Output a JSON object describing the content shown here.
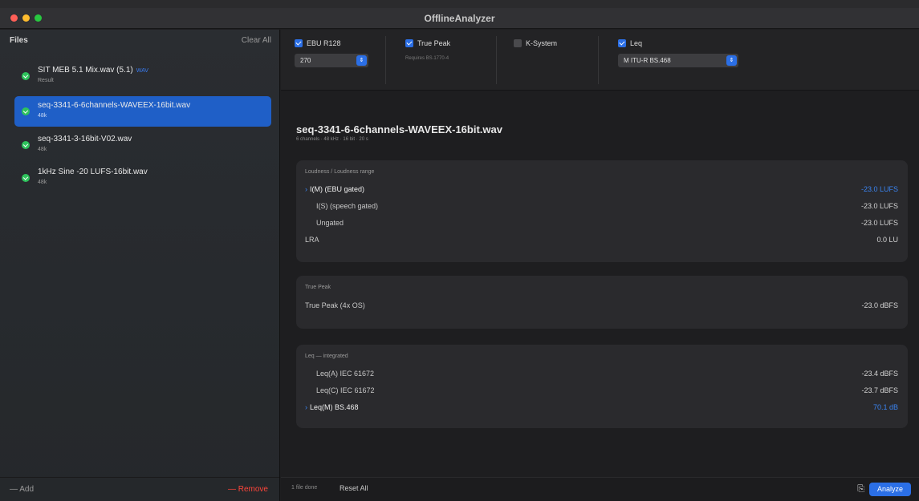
{
  "window": {
    "title": "OfflineAnalyzer"
  },
  "sidebar": {
    "header_label": "Files",
    "clear_label": "Clear All",
    "items": [
      {
        "name": "SIT MEB 5.1 Mix.wav (5.1)",
        "badge": "WAV",
        "sub": "Result"
      },
      {
        "name": "seq-3341-6-6channels-WAVEEX-16bit.wav",
        "sub": "48k"
      },
      {
        "name": "seq-3341-3-16bit-V02.wav",
        "sub": "48k"
      },
      {
        "name": "1kHz Sine -20 LUFS-16bit.wav",
        "sub": "48k"
      }
    ],
    "add_label": "Add",
    "remove_label": "Remove"
  },
  "toolbar": {
    "ebu_label": "EBU R128",
    "ebu_select": "270",
    "truepeak_label": "True Peak",
    "truepeak_hint": "Requires BS.1770-4",
    "k_label": "K-System",
    "leq_label": "Leq",
    "leq_select": "M ITU-R BS.468"
  },
  "content": {
    "file_title": "seq-3341-6-6channels-WAVEEX-16bit.wav",
    "file_meta": "6 channels · 48 kHz · 16 bit · 20 s",
    "loudness_title": "Loudness / Loudness range",
    "loudness_rows": [
      {
        "label": "I(M) (EBU gated)",
        "value": "-23.0 LUFS"
      },
      {
        "label": "I(S) (speech gated)",
        "value": "-23.0 LUFS"
      },
      {
        "label": "Ungated",
        "value": "-23.0 LUFS"
      },
      {
        "label": "LRA",
        "value": "0.0 LU"
      }
    ],
    "truepeak_title": "True Peak",
    "truepeak_rows": [
      {
        "label": "True Peak (4x OS)",
        "value": "-23.0 dBFS"
      }
    ],
    "leq_title": "Leq — integrated",
    "leq_rows": [
      {
        "label": "Leq(A) IEC 61672",
        "value": "-23.4 dBFS"
      },
      {
        "label": "Leq(C) IEC 61672",
        "value": "-23.7 dBFS"
      },
      {
        "label": "Leq(M) BS.468",
        "value": "70.1 dB"
      }
    ]
  },
  "bottombar": {
    "status": "1 file done",
    "reset_label": "Reset All",
    "copy_icon": "⎘",
    "analyze_label": "Analyze"
  },
  "colors": {
    "accent": "#2b6fe6",
    "success": "#2ec35c",
    "danger": "#ff453a"
  }
}
